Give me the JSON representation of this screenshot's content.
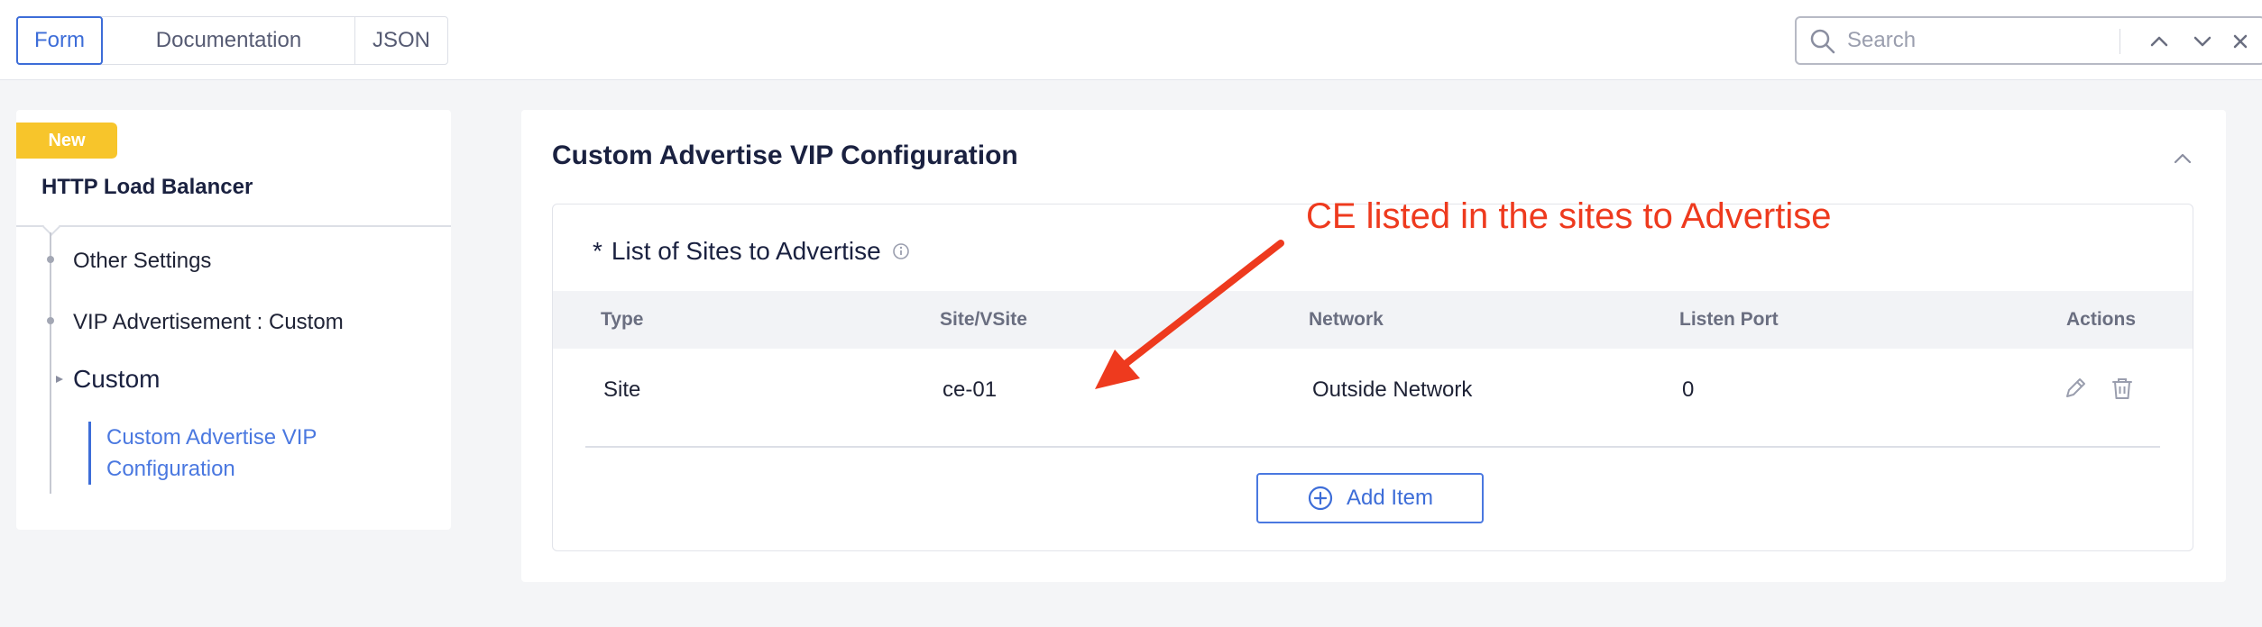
{
  "tabs": [
    {
      "label": "Form",
      "active": true
    },
    {
      "label": "Documentation",
      "active": false
    },
    {
      "label": "JSON",
      "active": false
    }
  ],
  "search": {
    "placeholder": "Search",
    "icons": [
      "search-icon",
      "chevron-up-icon",
      "chevron-down-icon",
      "close-icon"
    ]
  },
  "sidebar": {
    "badge": "New",
    "title": "HTTP Load Balancer",
    "items": [
      {
        "label": "Other Settings"
      },
      {
        "label": "VIP Advertisement : Custom"
      },
      {
        "label": "Custom"
      }
    ],
    "active_link": {
      "line1": "Custom Advertise VIP",
      "line2": "Configuration"
    }
  },
  "main": {
    "title": "Custom Advertise VIP Configuration",
    "list": {
      "required_marker": "*",
      "title": "List of Sites to Advertise",
      "columns": [
        "Type",
        "Site/VSite",
        "Network",
        "Listen Port",
        "Actions"
      ],
      "rows": [
        {
          "type": "Site",
          "site": "ce-01",
          "network": "Outside Network",
          "port": "0"
        }
      ],
      "row_actions": [
        "edit-icon",
        "trash-icon"
      ],
      "add_label": "Add Item"
    }
  },
  "annotation": {
    "text": "CE listed in the sites to Advertise",
    "color": "#ee3a1e"
  },
  "colors": {
    "accent": "#3d6dd8",
    "badge": "#f7c52b",
    "title": "#1a2140"
  }
}
